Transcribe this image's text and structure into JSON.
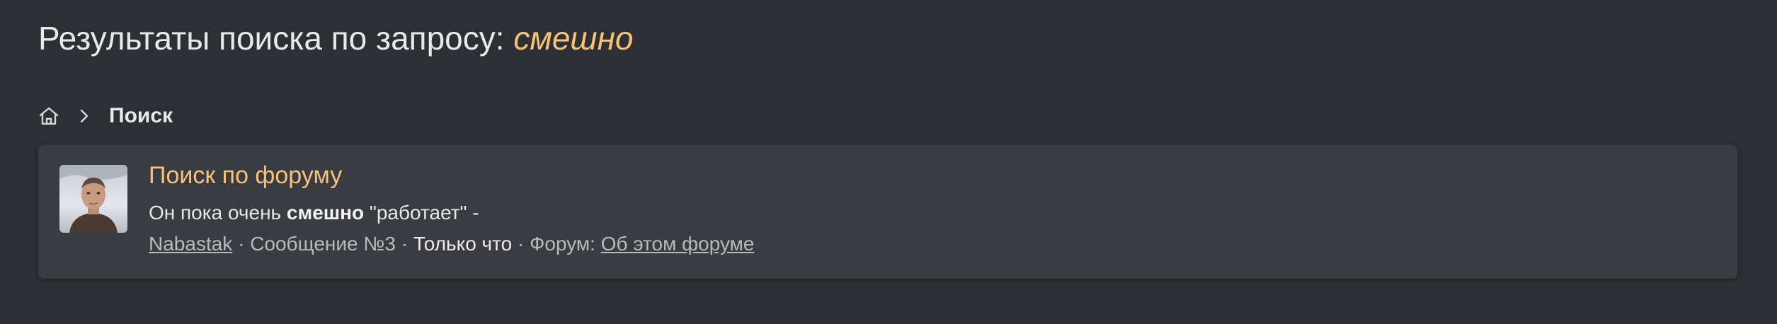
{
  "header": {
    "title_prefix": "Результаты поиска по запросу: ",
    "query": "смешно"
  },
  "breadcrumb": {
    "home_icon": "home-icon",
    "separator_icon": "chevron-right-icon",
    "current": "Поиск"
  },
  "result": {
    "title": "Поиск по форуму",
    "snippet_before": "Он пока очень ",
    "snippet_highlight": "смешно",
    "snippet_after": " \"работает\" -",
    "author": "Nabastak",
    "separator": " · ",
    "post_label": "Сообщение №3",
    "time": "Только что",
    "forum_label": "Форум: ",
    "forum_name": "Об этом форуме"
  },
  "colors": {
    "background": "#2d2f34",
    "card": "#3a3c41",
    "accent": "#f5c27a"
  }
}
